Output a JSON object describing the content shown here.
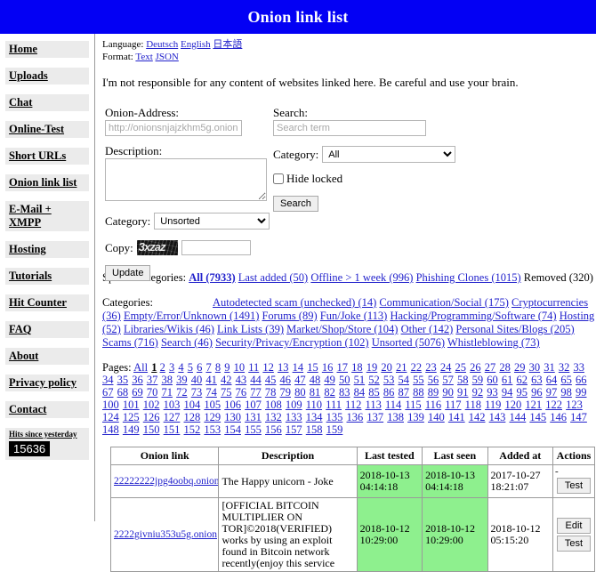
{
  "header": {
    "title": "Onion link list",
    "bg": "#0300f4"
  },
  "sidebar": {
    "items": [
      {
        "label": "Home",
        "name": "home"
      },
      {
        "label": "Uploads",
        "name": "uploads"
      },
      {
        "label": "Chat",
        "name": "chat"
      },
      {
        "label": "Online-Test",
        "name": "online-test"
      },
      {
        "label": "Short URLs",
        "name": "short-urls"
      },
      {
        "label": "Onion link list",
        "name": "onion-link-list"
      },
      {
        "label": "E-Mail + XMPP",
        "name": "email-xmpp"
      },
      {
        "label": "Hosting",
        "name": "hosting"
      },
      {
        "label": "Tutorials",
        "name": "tutorials"
      },
      {
        "label": "Hit Counter",
        "name": "hit-counter"
      },
      {
        "label": "FAQ",
        "name": "faq"
      },
      {
        "label": "About",
        "name": "about"
      },
      {
        "label": "Privacy policy",
        "name": "privacy-policy"
      },
      {
        "label": "Contact",
        "name": "contact"
      }
    ],
    "hits": {
      "label": "Hits since yesterday",
      "value": "15636"
    }
  },
  "meta": {
    "language_label": "Language:",
    "languages": [
      "Deutsch",
      "English",
      "日本語"
    ],
    "format_label": "Format:",
    "formats": [
      "Text",
      "JSON"
    ],
    "disclaimer": "I'm not responsible for any content of websites linked here. Be careful and use your brain."
  },
  "form": {
    "onion_address_label": "Onion-Address:",
    "onion_address_value": "",
    "onion_address_placeholder": "http://onionsnjajzkhm5g.onion",
    "description_label": "Description:",
    "description_value": "",
    "category_label": "Category:",
    "category_value": "Unsorted",
    "category_options": [
      "Unsorted"
    ],
    "copy_label": "Copy:",
    "captcha_text": "3xzaz",
    "captcha_value": "",
    "update_label": "Update"
  },
  "search": {
    "search_label": "Search:",
    "search_value": "",
    "search_placeholder": "Search term",
    "category_label": "Category:",
    "category_value": "All",
    "category_options": [
      "All"
    ],
    "hide_locked_label": "Hide locked",
    "hide_locked_checked": false,
    "search_button": "Search"
  },
  "special_categories": {
    "label": "Special categories:",
    "items": [
      {
        "label": "All (7933)",
        "current": true
      },
      {
        "label": "Last added (50)",
        "current": false
      },
      {
        "label": "Offline > 1 week (996)",
        "current": false
      },
      {
        "label": "Phishing Clones (1015)",
        "current": false
      },
      {
        "label": "Removed (320)",
        "current": false,
        "plain": true
      }
    ]
  },
  "categories": {
    "label": "Categories:",
    "items": [
      "Autodetected scam (unchecked) (14)",
      "Communication/Social (175)",
      "Cryptocurrencies (36)",
      "Empty/Error/Unknown (1491)",
      "Forums (89)",
      "Fun/Joke (113)",
      "Hacking/Programming/Software (74)",
      "Hosting (52)",
      "Libraries/Wikis (46)",
      "Link Lists (39)",
      "Market/Shop/Store (104)",
      "Other (142)",
      "Personal Sites/Blogs (205)",
      "Scams (716)",
      "Search (46)",
      "Security/Privacy/Encryption (102)",
      "Unsorted (5076)",
      "Whistleblowing (73)"
    ]
  },
  "pages": {
    "label": "Pages:",
    "all_label": "All",
    "current": 1,
    "last": 159
  },
  "table": {
    "columns": [
      "Onion link",
      "Description",
      "Last tested",
      "Last seen",
      "Added at",
      "Actions"
    ],
    "rows": [
      {
        "link": "22222222jpg4oobq.onion",
        "description": "The Happy unicorn - Joke",
        "last_tested": "2018-10-13 04:14:18",
        "last_seen": "2018-10-13 04:14:18",
        "added_at": "2017-10-27 18:21:07",
        "actions_prefix": "-",
        "actions": [
          "Test"
        ]
      },
      {
        "link": "2222givniu353u5g.onion",
        "description": "[OFFICIAL BITCOIN MULTIPLIER ON TOR]©2018(VERIFIED)\nworks by using an exploit found in Bitcoin network recently(enjoy this service",
        "last_tested": "2018-10-12 10:29:00",
        "last_seen": "2018-10-12 10:29:00",
        "added_at": "2018-10-12 05:15:20",
        "actions_prefix": "",
        "actions": [
          "Edit",
          "Test"
        ]
      }
    ]
  }
}
